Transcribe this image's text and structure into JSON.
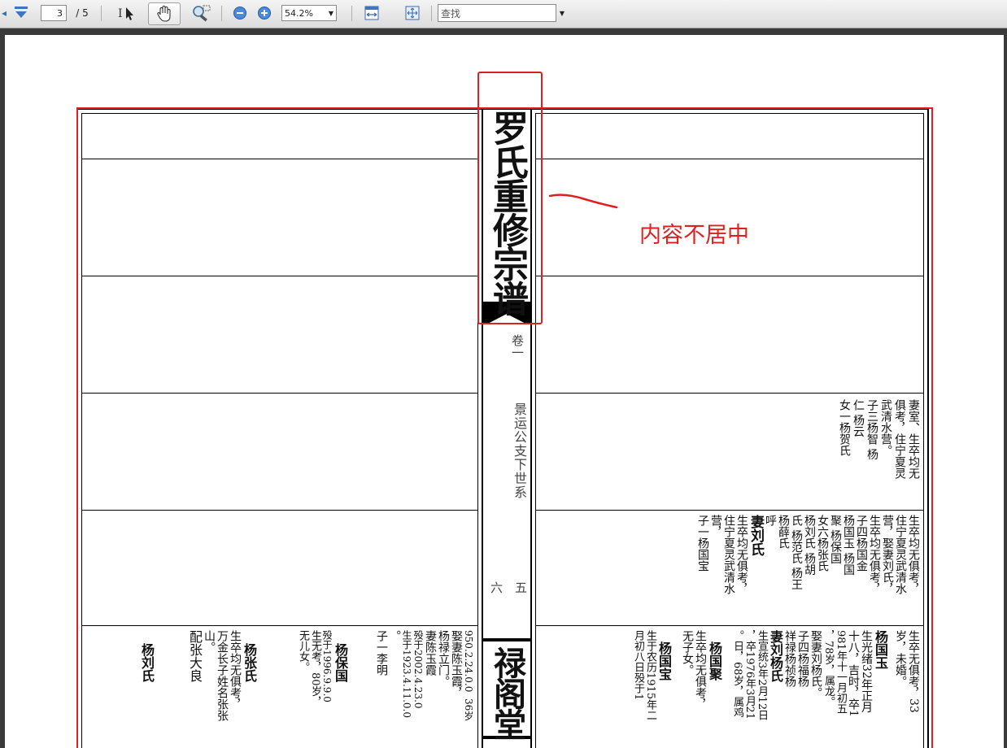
{
  "toolbar": {
    "page_current": "3",
    "page_total": "/ 5",
    "zoom": "54.2%",
    "search_placeholder": "查找"
  },
  "document": {
    "spine_title": "罗氏重修宗谱",
    "volume": "卷一",
    "branch": "景运公支下世系",
    "page_left_num": "六",
    "page_right_num": "五",
    "hall_name": "禄阁堂"
  },
  "annotation": {
    "note": "内容不居中",
    "color": "#e02020"
  },
  "left_entries": [
    "杨刘氏",
    "配张大良",
    "山。",
    "万金长子姓名张张",
    "生卒均无俱考，",
    "杨张氏",
    "无儿女。",
    "生无考，80岁，",
    "殁于1996.9.9.0",
    "杨保国",
    "子一李明",
    "。",
    "生于1923.4.11.0.0",
    "殁于2002.4.23.0",
    "妻陈玉霞",
    "杨禄立门。",
    "娶妻陈玉霞，",
    "950.2.24.0.0  36岁"
  ],
  "right_entries": [
    "月初八日殁于1",
    "生于农历1915年二",
    "杨国宝",
    "无子女。",
    "生卒均无俱考，",
    "杨国聚",
    "。日，68岁，属鸡",
    "，卒1976年3月21",
    "生宣统3年2月12日",
    "妻刘杨氏",
    "祥禄杨祯杨",
    "子四杨福杨",
    "娶妻刘杨氏。",
    "，78岁，属龙。",
    "981年十一月初五",
    "十八，吉时，卒1",
    "生光绪32年正月",
    "杨国玉",
    "岁，未婚。",
    "生卒无俱考，33"
  ],
  "right_mid_entries": [
    "子一杨国宝",
    "营，",
    "住宁夏灵武清水",
    "生卒均无俱考，",
    "妻刘氏",
    "呼",
    "杨薛氏",
    "氏 杨范氏 杨王",
    "杨刘氏 杨胡",
    "女六杨张氏",
    "聚 杨保国",
    "杨国玉 杨国",
    "子四杨国金",
    "生卒均无俱考，",
    "营，娶妻刘氏，",
    "住宁夏灵武清水",
    "生卒均无俱考，"
  ],
  "right_upper_entries": [
    "女一杨贺氏",
    "仁 杨云",
    "子三杨智 杨",
    "武清水营。",
    "俱考，住宁夏灵",
    "妻室、生卒均无"
  ]
}
